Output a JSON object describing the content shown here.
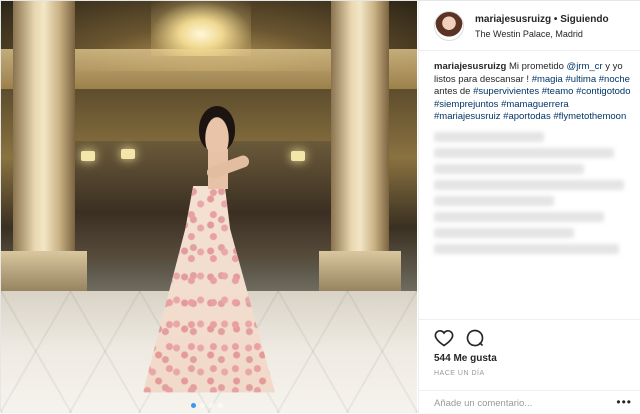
{
  "header": {
    "username": "mariajesusruizg",
    "separator": " • ",
    "follow_status": "Siguiendo",
    "location": "The Westin Palace, Madrid"
  },
  "caption": {
    "username": "mariajesusruizg",
    "text_before": "Mi prometido ",
    "mention": "@jrm_cr",
    "text_mid": " y yo listos para descansar ! ",
    "hashtags_1": [
      "#magia",
      "#ultima",
      "#noche"
    ],
    "text_antes": " antes de ",
    "hashtags_2": [
      "#supervivientes",
      "#teamo",
      "#contigotodo",
      "#siemprejuntos",
      "#mamaguerrera",
      "#mariajesusruiz",
      "#aportodas",
      "#flymetothemoon"
    ]
  },
  "post": {
    "likes": "544 Me gusta",
    "time_ago": "HACE UN DÍA"
  },
  "comment_box": {
    "placeholder": "Añade un comentario...",
    "more": "•••"
  },
  "carousel": {
    "count": 4,
    "active_index": 0
  },
  "colors": {
    "link": "#003569",
    "active_dot": "#3897f0"
  }
}
